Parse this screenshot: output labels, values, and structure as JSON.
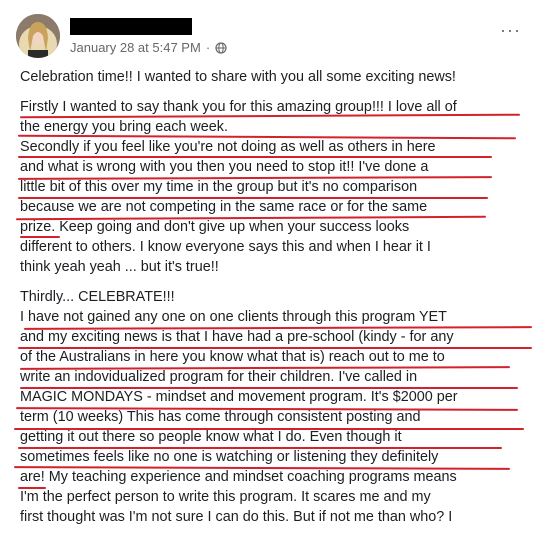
{
  "post": {
    "timestamp": "January 28 at 5:47 PM",
    "separator": "·",
    "more_label": "···",
    "icons": {
      "privacy": "globe-icon",
      "more": "more-options-icon"
    }
  },
  "content": {
    "p1": [
      "Celebration time!! I wanted to share with you all some exciting news!"
    ],
    "p2": [
      "Firstly I wanted to say thank you for this amazing group!!! I love all of",
      "the energy you bring each week.",
      "Secondly if you feel like you're not doing as well as others in here",
      "and what is wrong with you then you need to stop it!! I've done a",
      "little bit of this over my time in the group but it's no comparison",
      "because we are not competing in the same race or for the same",
      "prize. Keep going and don't give up when your success looks",
      "different to others. I know everyone says this and when I hear it I",
      "think yeah yeah ... but it's true!!"
    ],
    "p3": [
      "Thirdly... CELEBRATE!!!",
      "I have not gained any one on one clients through this program YET",
      "and my exciting news is that I have had a pre-school (kindy - for any",
      "of the Australians in here you know what that is) reach out to me to",
      "write an indovidualized program for their children. I've called in",
      "MAGIC MONDAYS - mindset and movement program. It's $2000 per",
      "term (10 weeks) This has come through consistent posting and",
      "getting it out there so people know what I do. Even though it",
      "sometimes feels like no one is watching or listening they definitely",
      "are! My teaching experience and mindset coaching programs means",
      "I'm the perfect person to write this program. It scares me and my",
      "first thought was I'm not sure I can do this. But if not me than who? I"
    ]
  },
  "annotation": {
    "underline_color": "#d3222c"
  }
}
